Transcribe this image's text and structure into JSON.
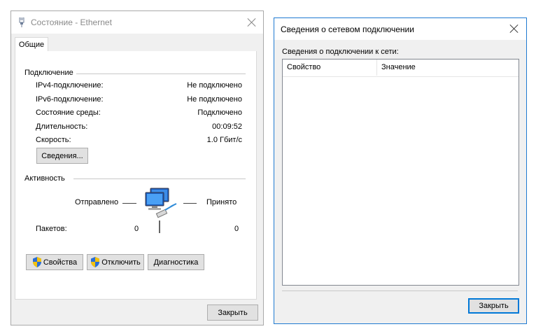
{
  "status_window": {
    "title": "Состояние - Ethernet",
    "tab_label": "Общие",
    "connection": {
      "heading": "Подключение",
      "rows": [
        {
          "label": "IPv4-подключение:",
          "value": "Не подключено"
        },
        {
          "label": "IPv6-подключение:",
          "value": "Не подключено"
        },
        {
          "label": "Состояние среды:",
          "value": "Подключено"
        },
        {
          "label": "Длительность:",
          "value": "00:09:52"
        },
        {
          "label": "Скорость:",
          "value": "1.0 Гбит/с"
        }
      ],
      "details_button": "Сведения..."
    },
    "activity": {
      "heading": "Активность",
      "sent_label": "Отправлено",
      "received_label": "Принято",
      "packets_label": "Пакетов:",
      "packets_sent": "0",
      "packets_received": "0"
    },
    "buttons": {
      "properties": "Свойства",
      "disable": "Отключить",
      "diagnose": "Диагностика",
      "close": "Закрыть"
    },
    "icons": {
      "app": "ethernet-plug-icon",
      "network": "network-computers-icon",
      "shield": "uac-shield-icon"
    }
  },
  "details_window": {
    "title": "Сведения о сетевом подключении",
    "list_caption": "Сведения о подключении к сети:",
    "columns": [
      "Свойство",
      "Значение"
    ],
    "close_button": "Закрыть"
  },
  "colors": {
    "accent": "#0078d7",
    "window_bg": "#f0f0f0",
    "panel_bg": "#ffffff",
    "button_face": "#e1e1e1",
    "inactive_title": "#8a8a8a"
  }
}
